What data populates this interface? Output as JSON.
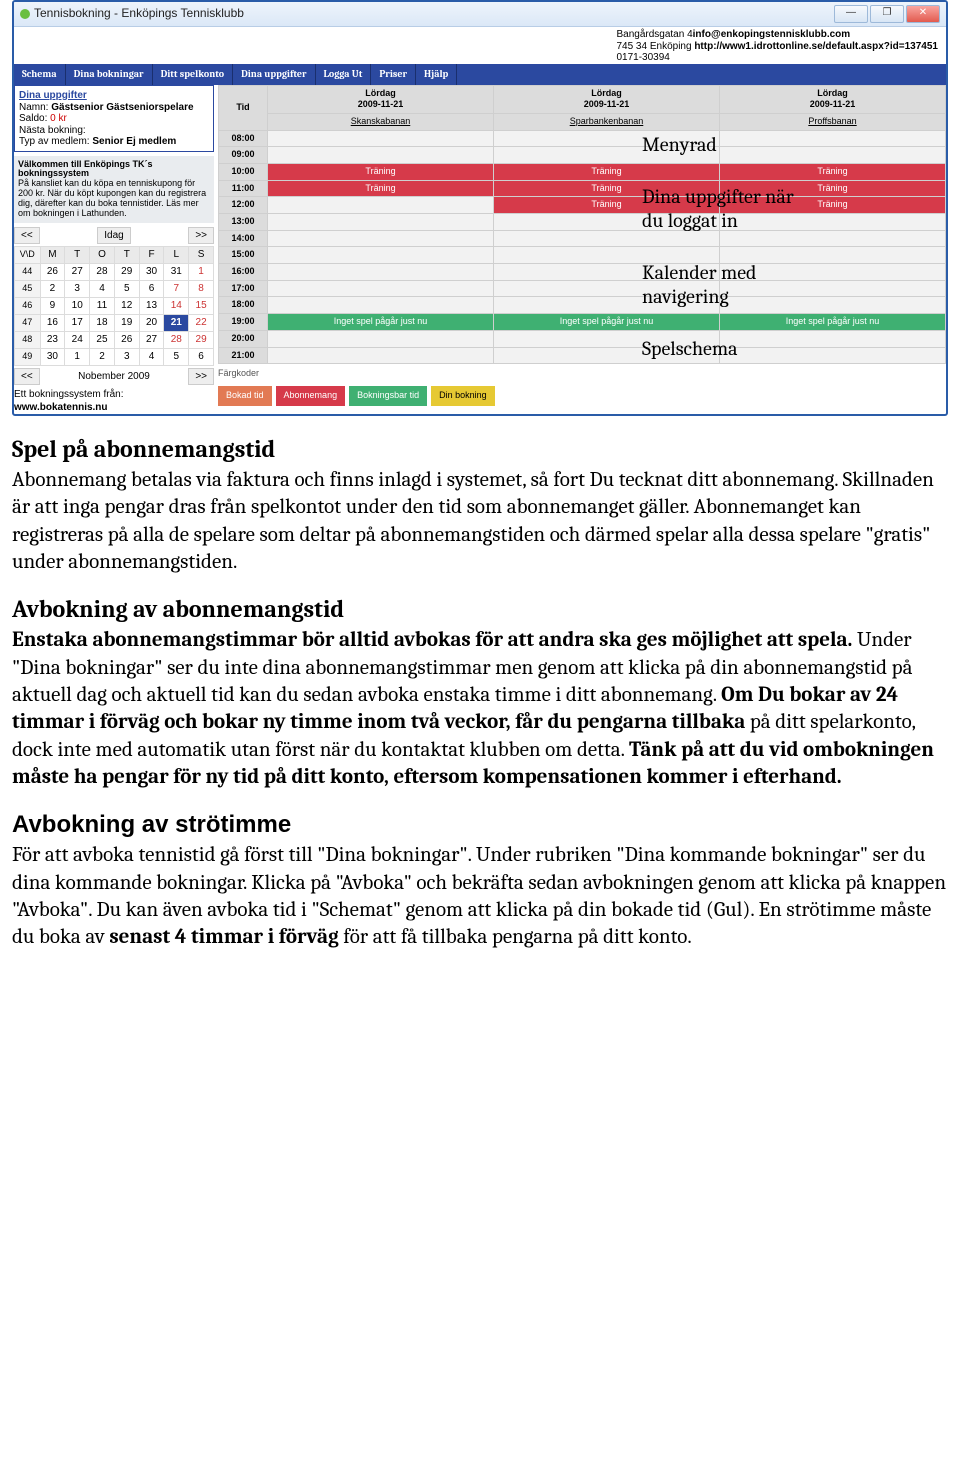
{
  "window": {
    "title": "Tennisbokning - Enköpings Tennisklubb",
    "min": "—",
    "max": "❐",
    "close": "✕"
  },
  "header": {
    "addr1": "Bangårdsgatan 4",
    "email": "info@enkopingstennisklubb.com",
    "addr2": "745 34 Enköping",
    "url": "http://www1.idrottonline.se/default.aspx?id=137451",
    "phone": "0171-30394"
  },
  "menu": [
    "Schema",
    "Dina bokningar",
    "Ditt spelkonto",
    "Dina uppgifter",
    "Logga Ut",
    "Priser",
    "Hjälp"
  ],
  "userpanel": {
    "title": "Dina uppgifter",
    "name_label": "Namn:",
    "name": "Gästsenior Gästseniorspelare",
    "saldo_label": "Saldo:",
    "saldo": "0 kr",
    "next_label": "Nästa bokning:",
    "type_label": "Typ av medlem:",
    "type": "Senior Ej medlem"
  },
  "welcome": {
    "title": "Välkommen till Enköpings TK´s bokningssystem",
    "body": "På kansliet kan du köpa en tenniskupong för 200 kr. När du köpt kupongen kan du registrera dig, därefter kan du boka tennistider. Läs mer om bokningen i Lathunden."
  },
  "calnav": {
    "prev": "<<",
    "today": "Idag",
    "next": ">>",
    "month_prev": "<<",
    "month": "Nobember 2009",
    "month_next": ">>"
  },
  "cal": {
    "head": [
      "V\\D",
      "M",
      "T",
      "O",
      "T",
      "F",
      "L",
      "S"
    ],
    "rows": [
      [
        "44",
        "26",
        "27",
        "28",
        "29",
        "30",
        "31",
        "1"
      ],
      [
        "45",
        "2",
        "3",
        "4",
        "5",
        "6",
        "7",
        "8"
      ],
      [
        "46",
        "9",
        "10",
        "11",
        "12",
        "13",
        "14",
        "15"
      ],
      [
        "47",
        "16",
        "17",
        "18",
        "19",
        "20",
        "21",
        "22"
      ],
      [
        "48",
        "23",
        "24",
        "25",
        "26",
        "27",
        "28",
        "29"
      ],
      [
        "49",
        "30",
        "1",
        "2",
        "3",
        "4",
        "5",
        "6"
      ]
    ]
  },
  "footer_note": {
    "line1": "Ett bokningssystem från:",
    "line2": "www.bokatennis.nu"
  },
  "sched": {
    "col0": "Tid",
    "dayhdr": "Lördag",
    "date": "2009-11-21",
    "courts": [
      "Skanskabanan",
      "Sparbankenbanan",
      "Proffsbanan"
    ],
    "times": [
      "08:00",
      "09:00",
      "10:00",
      "11:00",
      "12:00",
      "13:00",
      "14:00",
      "15:00",
      "16:00",
      "17:00",
      "18:00",
      "19:00",
      "20:00",
      "21:00"
    ],
    "training": "Träning",
    "nogame": "Inget spel pågår just nu"
  },
  "legend": {
    "title": "Färgkoder",
    "items": [
      "Bokad tid",
      "Abonnemang",
      "Bokningsbar tid",
      "Din bokning"
    ]
  },
  "annot": {
    "a1": "Menyrad",
    "a2a": "Dina uppgifter när",
    "a2b": "du loggat in",
    "a3a": "Kalender med",
    "a3b": "navigering",
    "a4": "Spelschema"
  },
  "sec1": {
    "h": "Spel på abonnemangstid",
    "p": "Abonnemang betalas via faktura och finns inlagd i systemet, så fort Du tecknat ditt abonnemang. Skillnaden är att inga pengar dras från spelkontot under den tid som abonnemanget gäller. Abonnemanget kan registreras på alla de spelare som deltar på abonnemangstiden och därmed spelar alla dessa spelare \"gratis\" under abonnemangstiden."
  },
  "sec2": {
    "h": "Avbokning av abonnemangstid",
    "b1": "Enstaka abonnemangstimmar bör alltid avbokas för att andra ska ges möjlighet att spela.",
    "t1": " Under \"Dina bokningar\" ser du inte dina abonnemangstimmar men genom att klicka på din abonnemangstid på aktuell dag och aktuell tid kan du sedan avboka enstaka timme i ditt abonnemang. ",
    "b2": "Om Du bokar av 24 timmar i förväg och bokar ny timme inom två veckor, får du pengarna tillbaka",
    "t2": " på ditt spelarkonto, dock inte med automatik utan först när du kontaktat klubben om detta. ",
    "b3": "Tänk på att du vid ombokningen måste ha pengar för ny tid på ditt konto, efter­som kompensationen kommer i efterhand."
  },
  "sec3": {
    "h": "Avbokning av strötimme",
    "t1": "För att avboka tennistid gå först till \"Dina bokningar\". Under rubriken \"Dina kommande bokningar\" ser du dina kommande bokningar. Klicka på \"Avboka\" och bekräfta sedan avbokningen genom att klicka på knappen \"Avboka\". Du kan även avboka tid i \"Schemat\" genom att klicka på din bokade tid (Gul).  En strötimme måste du boka av ",
    "b1": "senast 4 timmar i förväg",
    "t2": " för att få tillbaka pengarna på ditt konto."
  }
}
